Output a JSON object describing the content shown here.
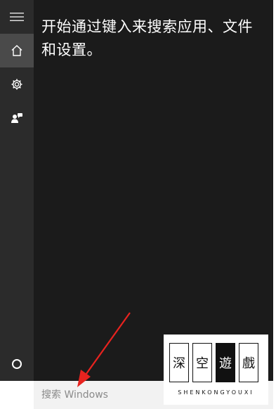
{
  "sidebar": {
    "buttons": [
      {
        "icon": "hamburger-menu-icon"
      },
      {
        "icon": "home-icon",
        "active": true
      },
      {
        "icon": "gear-icon"
      },
      {
        "icon": "feedback-person-icon"
      },
      {
        "icon": "cortana-circle-icon"
      }
    ]
  },
  "main": {
    "hint_text": "开始通过键入来搜索应用、文件和设置。"
  },
  "search": {
    "placeholder": "搜索 Windows"
  },
  "watermark": {
    "chars": [
      "深",
      "空",
      "遊",
      "戲"
    ],
    "subtitle": "SHENKONGYOUXI"
  },
  "colors": {
    "sidebar": "#2b2b2b",
    "panel": "#1b1b1b",
    "active": "#4a4a4a",
    "arrow": "#e8231f"
  }
}
